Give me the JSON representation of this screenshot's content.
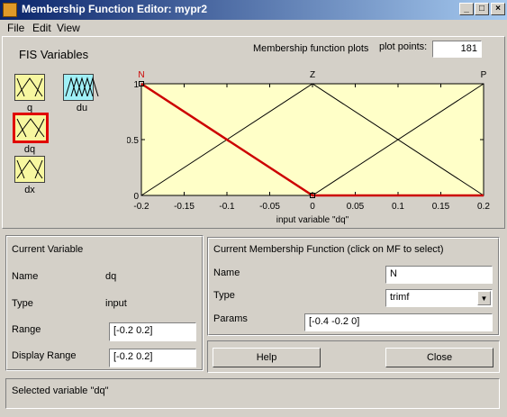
{
  "window": {
    "title": "Membership Function Editor: mypr2"
  },
  "menu": [
    {
      "label": "File"
    },
    {
      "label": "Edit"
    },
    {
      "label": "View"
    }
  ],
  "fis": {
    "heading": "FIS Variables",
    "variables": [
      {
        "label": "q",
        "type": "input",
        "color": "#f7f7a0"
      },
      {
        "label": "du",
        "type": "output",
        "color": "#a0f0f7"
      },
      {
        "label": "dq",
        "type": "input",
        "color": "#f7f7a0",
        "selected": true
      },
      {
        "label": "dx",
        "type": "input",
        "color": "#f7f7a0"
      }
    ]
  },
  "plot": {
    "heading": "Membership function plots",
    "points_label": "plot points:",
    "points_value": "181",
    "xlabel": "input variable \"dq\""
  },
  "chart_data": {
    "type": "line",
    "xlabel": "input variable \"dq\"",
    "xlim": [
      -0.2,
      0.2
    ],
    "ylim": [
      0,
      1
    ],
    "xticks": [
      "-0.2",
      "-0.15",
      "-0.1",
      "-0.05",
      "0",
      "0.05",
      "0.1",
      "0.15",
      "0.2"
    ],
    "yticks": [
      "0",
      "0.5",
      "1"
    ],
    "background": "#ffffc8",
    "series": [
      {
        "name": "N",
        "params": [
          -0.4,
          -0.2,
          0
        ],
        "points": [
          [
            -0.2,
            1
          ],
          [
            0,
            0
          ],
          [
            0.2,
            0
          ]
        ],
        "color": "#cc0000",
        "selected": true
      },
      {
        "name": "Z",
        "params": [
          -0.2,
          0,
          0.2
        ],
        "points": [
          [
            -0.2,
            0
          ],
          [
            0,
            1
          ],
          [
            0.2,
            0
          ]
        ],
        "color": "#000000"
      },
      {
        "name": "P",
        "params": [
          0,
          0.2,
          0.4
        ],
        "points": [
          [
            -0.2,
            0
          ],
          [
            0,
            0
          ],
          [
            0.2,
            1
          ]
        ],
        "color": "#000000"
      }
    ]
  },
  "current_variable": {
    "heading": "Current Variable",
    "name_label": "Name",
    "name_value": "dq",
    "type_label": "Type",
    "type_value": "input",
    "range_label": "Range",
    "range_value": "[-0.2 0.2]",
    "display_range_label": "Display Range",
    "display_range_value": "[-0.2 0.2]"
  },
  "current_mf": {
    "heading": "Current Membership Function (click on MF to select)",
    "name_label": "Name",
    "name_value": "N",
    "type_label": "Type",
    "type_value": "trimf",
    "params_label": "Params",
    "params_value": "[-0.4 -0.2 0]"
  },
  "buttons": {
    "help": "Help",
    "close": "Close"
  },
  "status": {
    "text": "Selected variable \"dq\""
  }
}
